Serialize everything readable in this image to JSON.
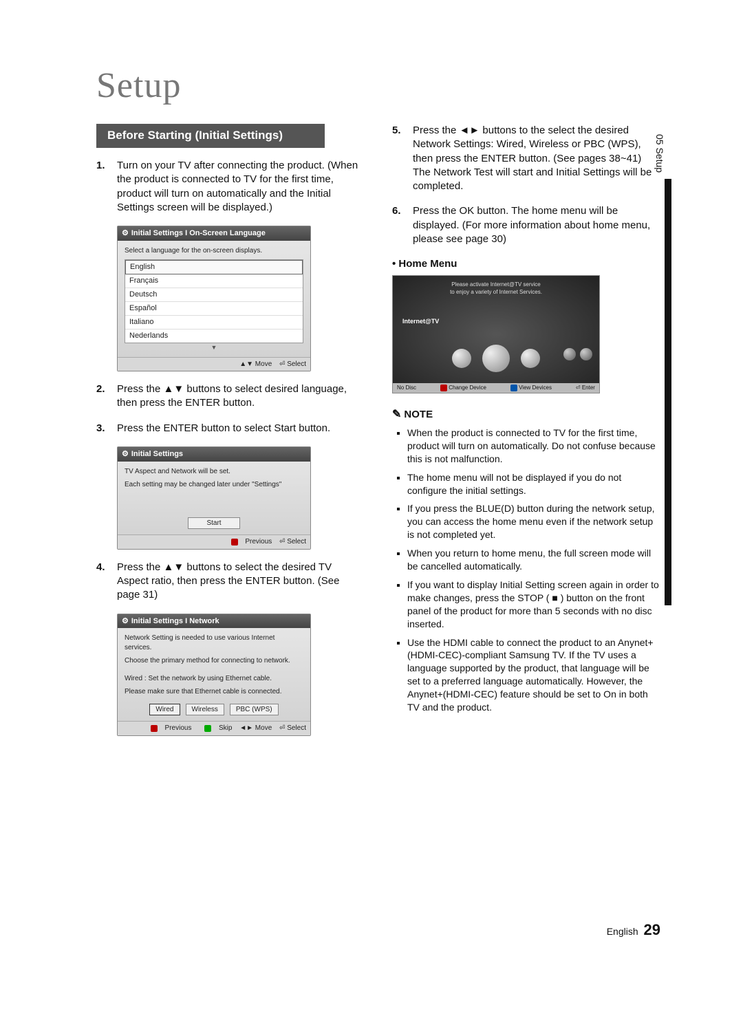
{
  "page": {
    "title": "Setup",
    "footer_lang": "English",
    "footer_page": "29",
    "side_tab": "05  Setup"
  },
  "section_header": "Before Starting (Initial Settings)",
  "steps_left": [
    {
      "n": "1.",
      "text": "Turn on your TV after connecting the product. (When the product is connected to TV for the first time, product will turn on automatically and the Initial Settings screen will be displayed.)"
    },
    {
      "n": "2.",
      "text": "Press the ▲▼ buttons to select desired language, then press the ENTER button."
    },
    {
      "n": "3.",
      "text": "Press the ENTER button to select Start button."
    },
    {
      "n": "4.",
      "text": "Press the ▲▼ buttons to select the desired TV Aspect ratio, then press the ENTER button. (See page 31)"
    }
  ],
  "steps_right": [
    {
      "n": "5.",
      "text": "Press the ◄► buttons to the select the desired Network Settings: Wired, Wireless or PBC (WPS), then press the ENTER button. (See pages 38~41) The Network Test will start and Initial Settings will be completed."
    },
    {
      "n": "6.",
      "text": "Press the OK button. The home menu will be displayed. (For more information about home menu, please see page 30)"
    }
  ],
  "home_menu_label": "• Home Menu",
  "osd1": {
    "title": "Initial Settings I On-Screen Language",
    "instr": "Select a language for the on-screen displays.",
    "langs": [
      "English",
      "Français",
      "Deutsch",
      "Español",
      "Italiano",
      "Nederlands"
    ],
    "footer_move": "▲▼ Move",
    "footer_select": "⏎ Select"
  },
  "osd2": {
    "title": "Initial Settings",
    "line1": "TV Aspect and Network will be set.",
    "line2": "Each setting may be changed later under \"Settings\"",
    "start": "Start",
    "footer_prev": "Previous",
    "footer_select": "⏎ Select"
  },
  "osd3": {
    "title": "Initial Settings I Network",
    "line1": "Network Setting is needed to use various Internet services.",
    "line2": "Choose the primary method for connecting to network.",
    "line3": "Wired : Set the network by using Ethernet cable.",
    "line4": "Please make sure that Ethernet cable is connected.",
    "btn_wired": "Wired",
    "btn_wireless": "Wireless",
    "btn_pbc": "PBC (WPS)",
    "footer_prev": "Previous",
    "footer_skip": "Skip",
    "footer_move": "◄► Move",
    "footer_select": "⏎ Select"
  },
  "home": {
    "msg1": "Please activate Internet@TV service",
    "msg2": "to enjoy a variety of Internet Services.",
    "badge": "Internet@TV",
    "foot_left": "No Disc",
    "foot_a": "Change Device",
    "foot_d": "View Devices",
    "foot_enter": "⏎ Enter"
  },
  "note_header": "NOTE",
  "notes": [
    "When the product is connected to TV for the first time, product will turn on automatically. Do not confuse because this is not malfunction.",
    "The home menu will not be displayed if you do not configure the initial settings.",
    "If you press the BLUE(D) button during the network setup, you can access the home menu even if the network setup is not completed yet.",
    "When you return to home menu, the full screen mode will be cancelled automatically.",
    "If you want to display Initial Setting screen again in order to make changes, press the STOP ( ■ ) button on the front panel of the product for more than 5 seconds with no disc inserted.",
    "Use the HDMI cable to connect the product to an Anynet+(HDMI-CEC)-compliant Samsung TV. If the TV uses a language supported by the product, that language will be set to a preferred language automatically. However, the Anynet+(HDMI-CEC) feature should be set to On in both TV and the product."
  ]
}
